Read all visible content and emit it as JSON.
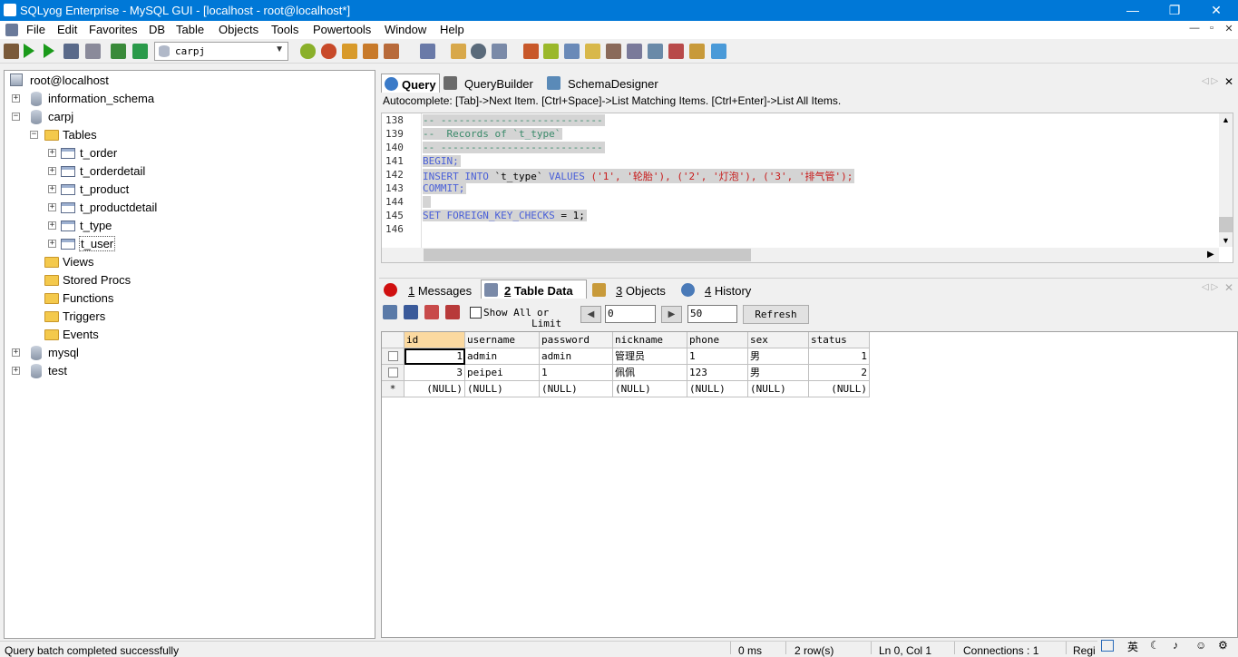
{
  "window": {
    "title": "SQLyog Enterprise - MySQL GUI - [localhost - root@localhost*]",
    "minimize": "—",
    "restore": "❐",
    "close": "✕"
  },
  "menu": [
    "File",
    "Edit",
    "Favorites",
    "DB",
    "Table",
    "Objects",
    "Tools",
    "Powertools",
    "Window",
    "Help"
  ],
  "mdi_controls": [
    "—",
    "▫",
    "✕"
  ],
  "toolbar": {
    "database_selector": "carpj"
  },
  "tree": {
    "root": "root@localhost",
    "nodes": [
      {
        "label": "information_schema",
        "expander": "+"
      },
      {
        "label": "carpj",
        "expander": "−"
      },
      {
        "label": "Tables",
        "expander": "−"
      },
      {
        "label": "t_order",
        "expander": "+"
      },
      {
        "label": "t_orderdetail",
        "expander": "+"
      },
      {
        "label": "t_product",
        "expander": "+"
      },
      {
        "label": "t_productdetail",
        "expander": "+"
      },
      {
        "label": "t_type",
        "expander": "+"
      },
      {
        "label": "t_user",
        "expander": "+"
      },
      {
        "label": "Views"
      },
      {
        "label": "Stored Procs"
      },
      {
        "label": "Functions"
      },
      {
        "label": "Triggers"
      },
      {
        "label": "Events"
      },
      {
        "label": "mysql",
        "expander": "+"
      },
      {
        "label": "test",
        "expander": "+"
      }
    ]
  },
  "query_tabs": {
    "tabs": [
      "Query",
      "QueryBuilder",
      "SchemaDesigner"
    ],
    "nav": "◁ ▷",
    "close": "✕"
  },
  "autocomplete_hint": "Autocomplete: [Tab]->Next Item. [Ctrl+Space]->List Matching Items. [Ctrl+Enter]->List All Items.",
  "editor": {
    "line_numbers": [
      "138",
      "139",
      "140",
      "141",
      "142",
      "143",
      "144",
      "145",
      "146"
    ],
    "lines": {
      "l138": "-- ---------------------------",
      "l139": "--  Records of `t_type`",
      "l140": "-- ---------------------------",
      "l141": "BEGIN;",
      "l142_kw1": "INSERT INTO",
      "l142_tbl": " `t_type` ",
      "l142_kw2": "VALUES",
      "l142_vals": " ('1', '轮胎'), ('2', '灯泡'), ('3', '排气管');",
      "l143": "COMMIT;",
      "l144": " ",
      "l145_kw": "SET FOREIGN_KEY_CHECKS",
      "l145_rest": " = 1;"
    }
  },
  "result_tabs": {
    "tabs": [
      {
        "key": "1",
        "label": " Messages"
      },
      {
        "key": "2",
        "label": " Table Data"
      },
      {
        "key": "3",
        "label": " Objects"
      },
      {
        "key": "4",
        "label": " History"
      }
    ],
    "nav": "◁ ▷",
    "close": "✕"
  },
  "result_toolbar": {
    "show_all": "Show All",
    "or": "or",
    "limit": "Limit",
    "offset_value": "0",
    "limit_value": "50",
    "prev": "◀",
    "next": "▶",
    "refresh": "Refresh"
  },
  "grid": {
    "columns": [
      "id",
      "username",
      "password",
      "nickname",
      "phone",
      "sex",
      "status"
    ],
    "rows": [
      [
        "1",
        "admin",
        "admin",
        "管理员",
        "1",
        "男",
        "1"
      ],
      [
        "3",
        "peipei",
        "1",
        "佩佩",
        "123",
        "男",
        "2"
      ],
      [
        "(NULL)",
        "(NULL)",
        "(NULL)",
        "(NULL)",
        "(NULL)",
        "(NULL)",
        "(NULL)"
      ]
    ],
    "new_row_marker": "*"
  },
  "status": {
    "message": "Query batch completed successfully",
    "time": "0 ms",
    "rows": "2 row(s)",
    "position": "Ln 0, Col 1",
    "connections": "Connections : 1",
    "reg": "Regi"
  },
  "tray": [
    "英",
    "♪",
    "⚙"
  ]
}
